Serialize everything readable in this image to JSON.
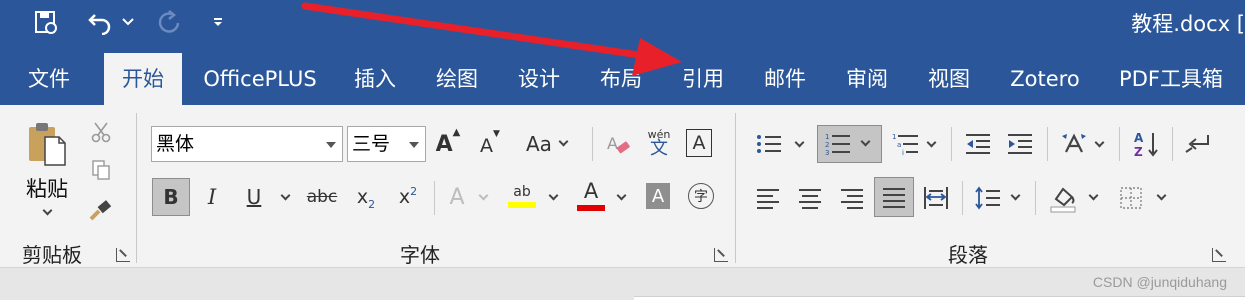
{
  "window": {
    "title": "教程.docx ["
  },
  "tabs": [
    "文件",
    "开始",
    "OfficePLUS",
    "插入",
    "绘图",
    "设计",
    "布局",
    "引用",
    "邮件",
    "审阅",
    "视图",
    "Zotero",
    "PDF工具箱"
  ],
  "active_tab": "开始",
  "clipboard": {
    "paste_label": "粘贴",
    "group_label": "剪贴板"
  },
  "font": {
    "family": "黑体",
    "size": "三号",
    "change_case": "Aa",
    "phonetic_small": "wén",
    "phonetic_big": "文",
    "char_border": "A",
    "bold": "B",
    "italic": "I",
    "underline": "U",
    "strike": "abc",
    "subscript": "x",
    "subscript_sub": "2",
    "superscript": "x",
    "superscript_sup": "2",
    "text_effect": "A",
    "highlight": "ab",
    "font_color": "A",
    "char_shading": "A",
    "enclose": "字",
    "grow": "A",
    "shrink": "A",
    "group_label": "字体"
  },
  "paragraph": {
    "group_label": "段落"
  },
  "colors": {
    "accent": "#2b579a",
    "highlight_yellow": "#ffff00",
    "font_red": "#e00000",
    "arrow_red": "#e8202a"
  },
  "watermark": "CSDN @junqiduhang"
}
